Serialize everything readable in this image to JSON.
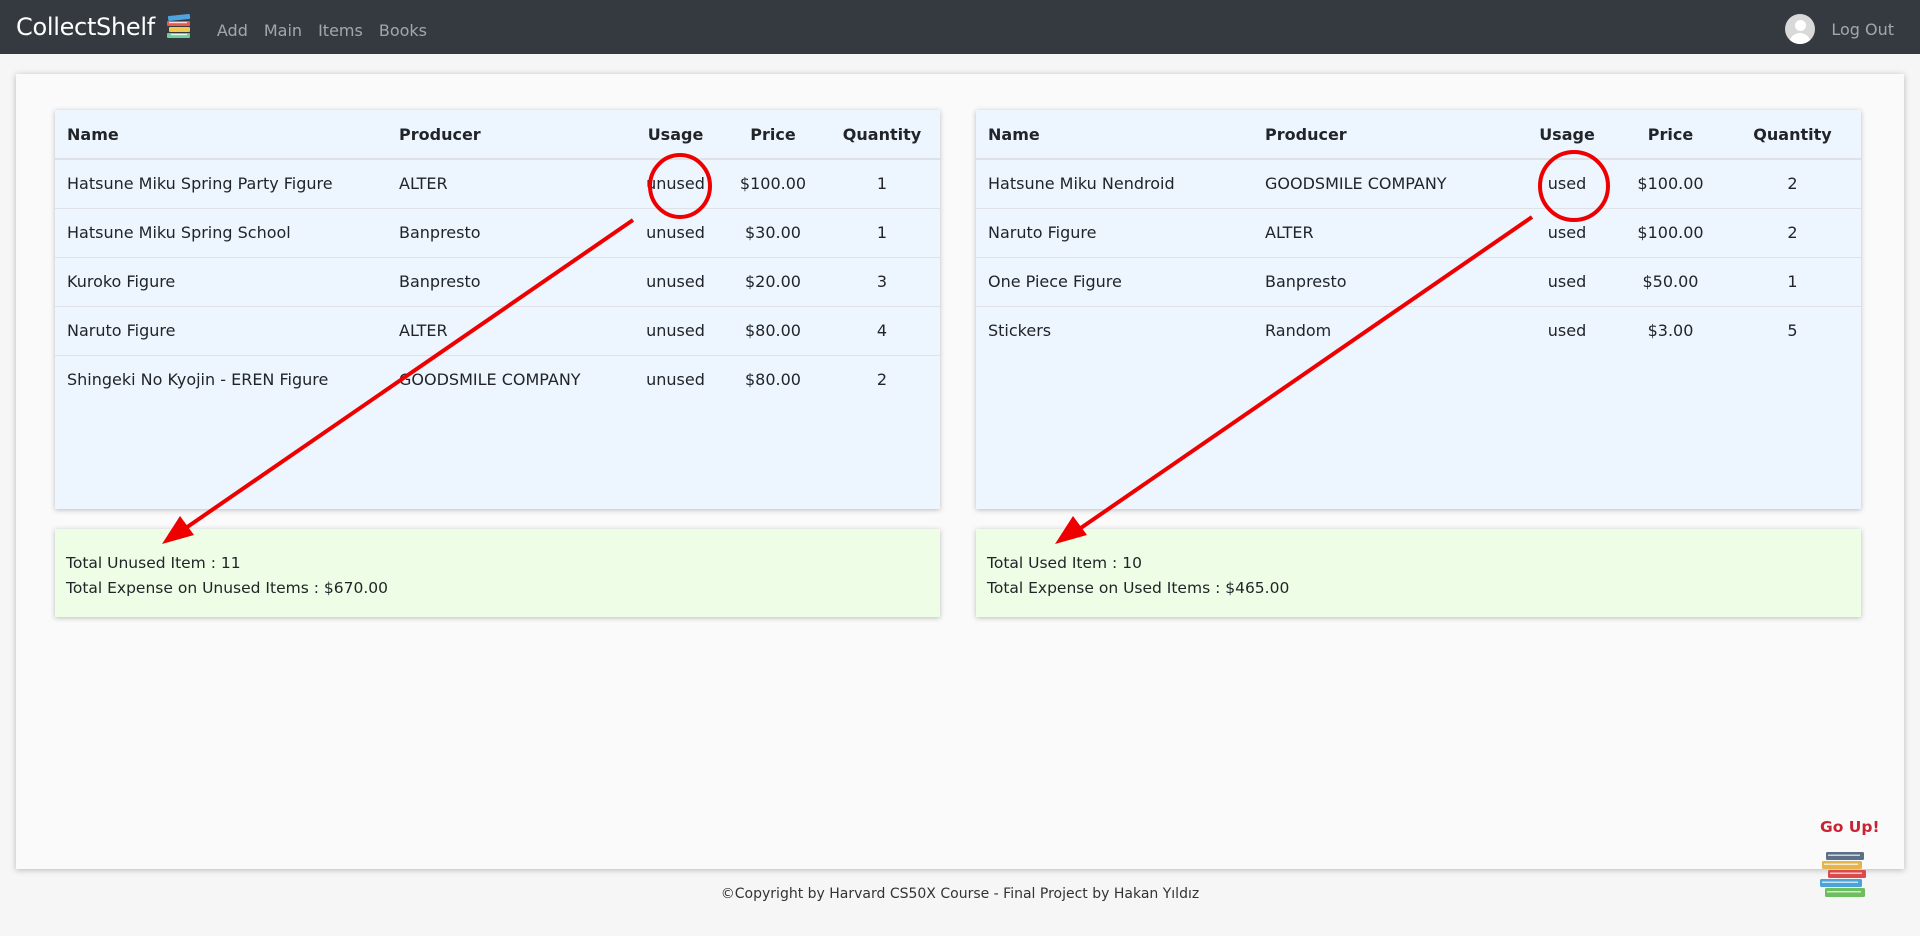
{
  "nav": {
    "brand": "CollectShelf",
    "links": [
      "Add",
      "Main",
      "Items",
      "Books"
    ],
    "logout": "Log Out"
  },
  "headers": [
    "Name",
    "Producer",
    "Usage",
    "Price",
    "Quantity"
  ],
  "unused_table": {
    "rows": [
      [
        "Hatsune Miku Spring Party Figure",
        "ALTER",
        "unused",
        "$100.00",
        "1"
      ],
      [
        "Hatsune Miku Spring School",
        "Banpresto",
        "unused",
        "$30.00",
        "1"
      ],
      [
        "Kuroko Figure",
        "Banpresto",
        "unused",
        "$20.00",
        "3"
      ],
      [
        "Naruto Figure",
        "ALTER",
        "unused",
        "$80.00",
        "4"
      ],
      [
        "Shingeki No Kyojin - EREN Figure",
        "GOODSMILE COMPANY",
        "unused",
        "$80.00",
        "2"
      ]
    ]
  },
  "used_table": {
    "rows": [
      [
        "Hatsune Miku Nendroid",
        "GOODSMILE COMPANY",
        "used",
        "$100.00",
        "2"
      ],
      [
        "Naruto Figure",
        "ALTER",
        "used",
        "$100.00",
        "2"
      ],
      [
        "One Piece Figure",
        "Banpresto",
        "used",
        "$50.00",
        "1"
      ],
      [
        "Stickers",
        "Random",
        "used",
        "$3.00",
        "5"
      ]
    ]
  },
  "summary_unused": {
    "total": "Total Unused Item : 11",
    "expense": "Total Expense on Unused Items : $670.00"
  },
  "summary_used": {
    "total": "Total Used Item : 10",
    "expense": "Total Expense on Used Items : $465.00"
  },
  "go_up": "Go Up!",
  "footer": "©Copyright by Harvard CS50X Course - Final Project by Hakan Yıldız",
  "colors": {
    "navbar": "#343a40",
    "table_bg": "#edf5fe",
    "summary_bg": "#eefde5",
    "annotation": "#ee0000",
    "go_up": "#c82333"
  },
  "icons": {
    "brand": "books-icon",
    "avatar": "user-avatar-icon",
    "go_up": "books-stack-icon"
  }
}
